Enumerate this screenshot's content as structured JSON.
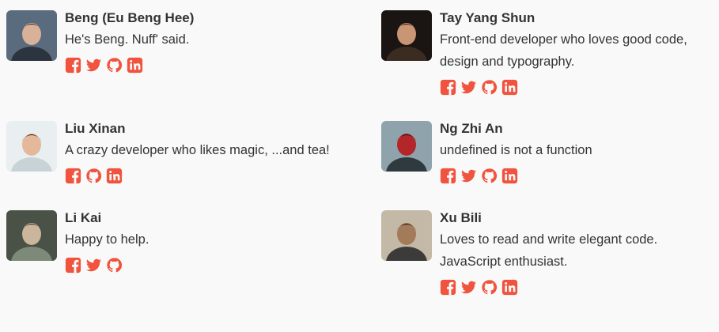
{
  "theme": {
    "icon_color": "#f0533e"
  },
  "members": [
    {
      "name": "Beng (Eu Beng Hee)",
      "bio": "He's Beng. Nuff' said.",
      "socials": [
        "facebook",
        "twitter",
        "github",
        "linkedin"
      ],
      "avatar_colors": [
        "#5a6b7d",
        "#2c3440",
        "#d9b199"
      ]
    },
    {
      "name": "Tay Yang Shun",
      "bio": "Front-end developer who loves good code, design and typography.",
      "socials": [
        "facebook",
        "twitter",
        "github",
        "linkedin"
      ],
      "avatar_colors": [
        "#1a1512",
        "#3b2c22",
        "#c99574"
      ]
    },
    {
      "name": "Liu Xinan",
      "bio": "A crazy developer who likes magic, ...and tea!",
      "socials": [
        "facebook",
        "github",
        "linkedin"
      ],
      "avatar_colors": [
        "#e9eef0",
        "#c8d3d8",
        "#e3b89b"
      ]
    },
    {
      "name": "Ng Zhi An",
      "bio": "undefined is not a function",
      "socials": [
        "facebook",
        "twitter",
        "github",
        "linkedin"
      ],
      "avatar_colors": [
        "#8fa3ad",
        "#2f3a3f",
        "#b3262a"
      ]
    },
    {
      "name": "Li Kai",
      "bio": "Happy to help.",
      "socials": [
        "facebook",
        "twitter",
        "github"
      ],
      "avatar_colors": [
        "#4a5146",
        "#7d8a79",
        "#cbb59d"
      ]
    },
    {
      "name": "Xu Bili",
      "bio": "Loves to read and write elegant code. JavaScript enthusiast.",
      "socials": [
        "facebook",
        "twitter",
        "github",
        "linkedin"
      ],
      "avatar_colors": [
        "#c4b8a6",
        "#3c3b3a",
        "#a37a5a"
      ]
    }
  ]
}
